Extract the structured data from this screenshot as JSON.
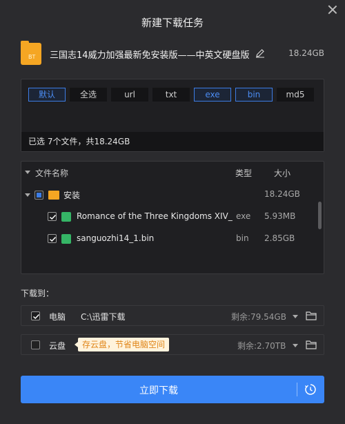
{
  "dialog": {
    "title": "新建下载任务"
  },
  "file": {
    "icon_label": "BT",
    "name": "三国志14威力加强最新免安装版——中英文硬盘版",
    "size": "18.24GB"
  },
  "filters": {
    "chips": [
      {
        "label": "默认",
        "active": true
      },
      {
        "label": "全选",
        "active": false
      },
      {
        "label": "url",
        "active": false
      },
      {
        "label": "txt",
        "active": false
      },
      {
        "label": "exe",
        "active": true
      },
      {
        "label": "bin",
        "active": true
      },
      {
        "label": "md5",
        "active": false
      }
    ],
    "summary": "已选 7个文件，共18.24GB"
  },
  "tree": {
    "headers": {
      "name": "文件名称",
      "type": "类型",
      "size": "大小"
    },
    "folder": {
      "name": "安装",
      "size": "18.24GB"
    },
    "files": [
      {
        "name": "Romance of the Three Kingdoms XIV_",
        "type": "exe",
        "size": "5.93MB"
      },
      {
        "name": "sanguozhi14_1.bin",
        "type": "bin",
        "size": "2.85GB"
      }
    ]
  },
  "download_to": {
    "label": "下载到：",
    "pc": {
      "name": "电脑",
      "path": "C:\\迅雷下载",
      "remaining": "剩余:79.54GB",
      "checked": true
    },
    "cloud": {
      "name": "云盘",
      "tip": "存云盘，节省电脑空间",
      "remaining": "剩余:2.70TB",
      "checked": false
    }
  },
  "actions": {
    "download_now": "立即下载"
  },
  "colors": {
    "accent": "#3a86f7",
    "folder": "#f5a623",
    "file_icon": "#35b566",
    "tip_text": "#e0861a"
  }
}
